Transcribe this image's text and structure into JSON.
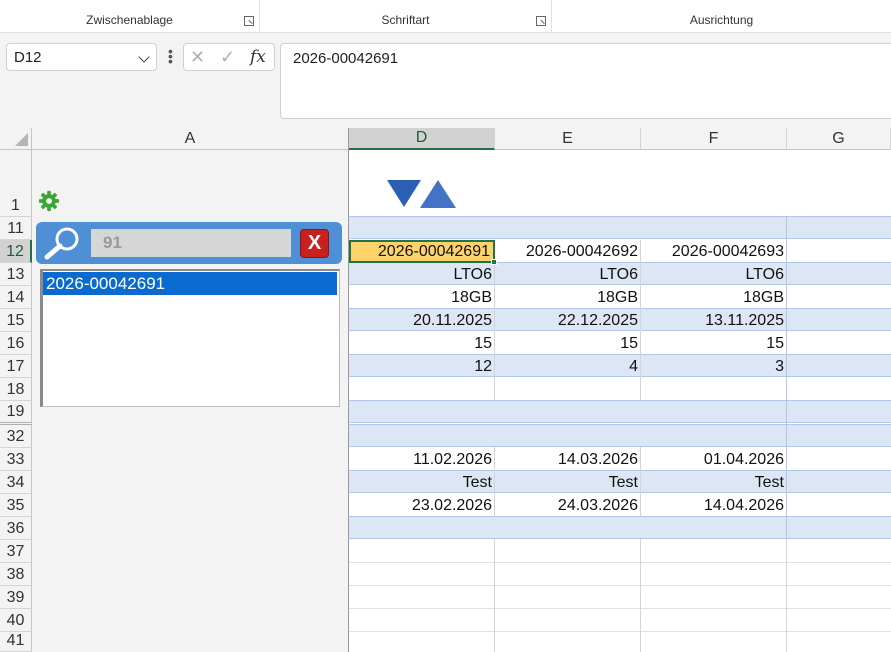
{
  "ribbon": {
    "groups": [
      "Zwischenablage",
      "Schriftart",
      "Ausrichtung"
    ]
  },
  "formula_bar": {
    "name_box": "D12",
    "cancel_icon": "✕",
    "enter_icon": "✓",
    "fx_label": "fx",
    "value": "2026-00042691"
  },
  "columns": [
    "A",
    "D",
    "E",
    "F",
    "G"
  ],
  "rows": [
    "1",
    "11",
    "12",
    "13",
    "14",
    "15",
    "16",
    "17",
    "18",
    "19",
    "32",
    "33",
    "34",
    "35",
    "36",
    "37",
    "38",
    "39",
    "40",
    "41"
  ],
  "search": {
    "query": "91",
    "clear_label": "X",
    "results": [
      "2026-00042691"
    ]
  },
  "cells": {
    "r12": [
      "2026-00042691",
      "2026-00042692",
      "2026-00042693"
    ],
    "r13": [
      "LTO6",
      "LTO6",
      "LTO6"
    ],
    "r14": [
      "18GB",
      "18GB",
      "18GB"
    ],
    "r15": [
      "20.11.2025",
      "22.12.2025",
      "13.11.2025"
    ],
    "r16": [
      "15",
      "15",
      "15"
    ],
    "r17": [
      "12",
      "4",
      "3"
    ],
    "r33": [
      "11.02.2026",
      "14.03.2026",
      "01.04.2026"
    ],
    "r34": [
      "Test",
      "Test",
      "Test"
    ],
    "r35": [
      "23.02.2026",
      "24.03.2026",
      "14.04.2026"
    ]
  },
  "colors": {
    "band": "#dce6f4",
    "active_cell": "#ffd36b",
    "selection": "#217346",
    "search_bar": "#4f8fd6",
    "clear_button": "#c9211e",
    "list_selected": "#0a6ad0",
    "gear": "#3aa635"
  }
}
